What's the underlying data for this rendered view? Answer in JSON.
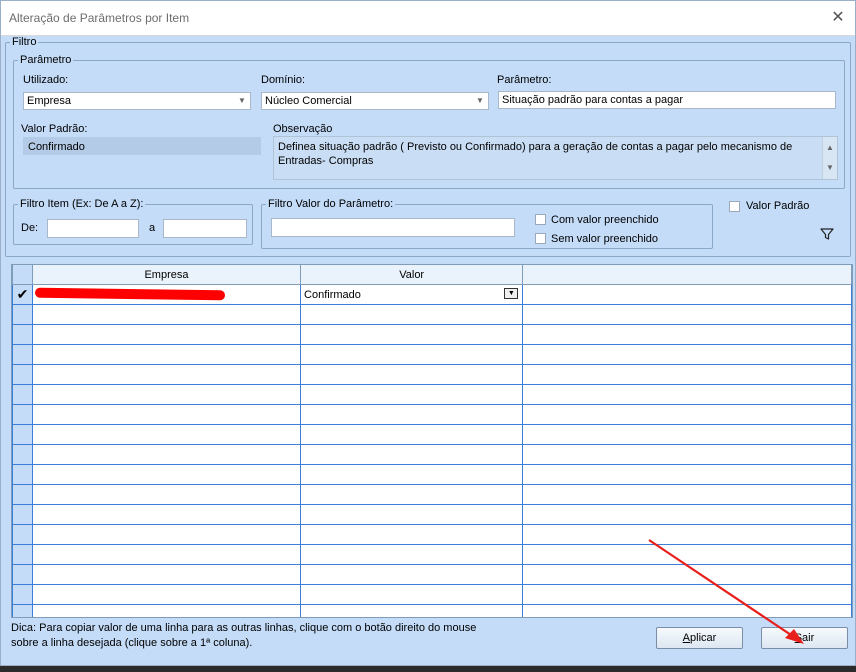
{
  "window": {
    "title": "Alteração de Parâmetros por Item",
    "close_symbol": "✕"
  },
  "filtro": {
    "legend": "Filtro",
    "parametro": {
      "legend": "Parâmetro",
      "utilizado_label": "Utilizado:",
      "utilizado_value": "Empresa",
      "dominio_label": "Domínio:",
      "dominio_value": "Núcleo Comercial",
      "parametro_label": "Parâmetro:",
      "parametro_value": "Situação  padrão para contas a pagar",
      "valor_padrao_label": "Valor Padrão:",
      "valor_padrao_value": "Confirmado",
      "observacao_label": "Observação",
      "observacao_value": "Definea situação  padrão ( Previsto ou Confirmado)  para a geração de contas a pagar pelo mecanismo de Entradas- Compras"
    },
    "filtro_item": {
      "legend": "Filtro Item (Ex: De A a Z):",
      "de_label": "De:",
      "de_value": "",
      "a_label": "a",
      "a_value": ""
    },
    "filtro_valor": {
      "legend": "Filtro Valor do Parâmetro:",
      "value": "",
      "com_valor_label": "Com valor preenchido",
      "sem_valor_label": "Sem valor preenchido"
    },
    "valor_padrao_check_label": "Valor Padrão"
  },
  "grid": {
    "columns": [
      "",
      "Empresa",
      "Valor",
      ""
    ],
    "rows": [
      {
        "indicator": "✔",
        "empresa": "",
        "valor": "Confirmado"
      }
    ]
  },
  "tip": {
    "line1": "Dica: Para copiar valor de uma linha para as outras linhas, clique com o botão direito do mouse",
    "line2": "sobre a linha desejada (clique sobre a 1ª coluna)."
  },
  "buttons": {
    "aplicar_first": "A",
    "aplicar_rest": "plicar",
    "sair_first": "S",
    "sair_rest": "air"
  },
  "colors": {
    "annotation_arrow": "#e8201c",
    "background": "#c4dcf8"
  }
}
